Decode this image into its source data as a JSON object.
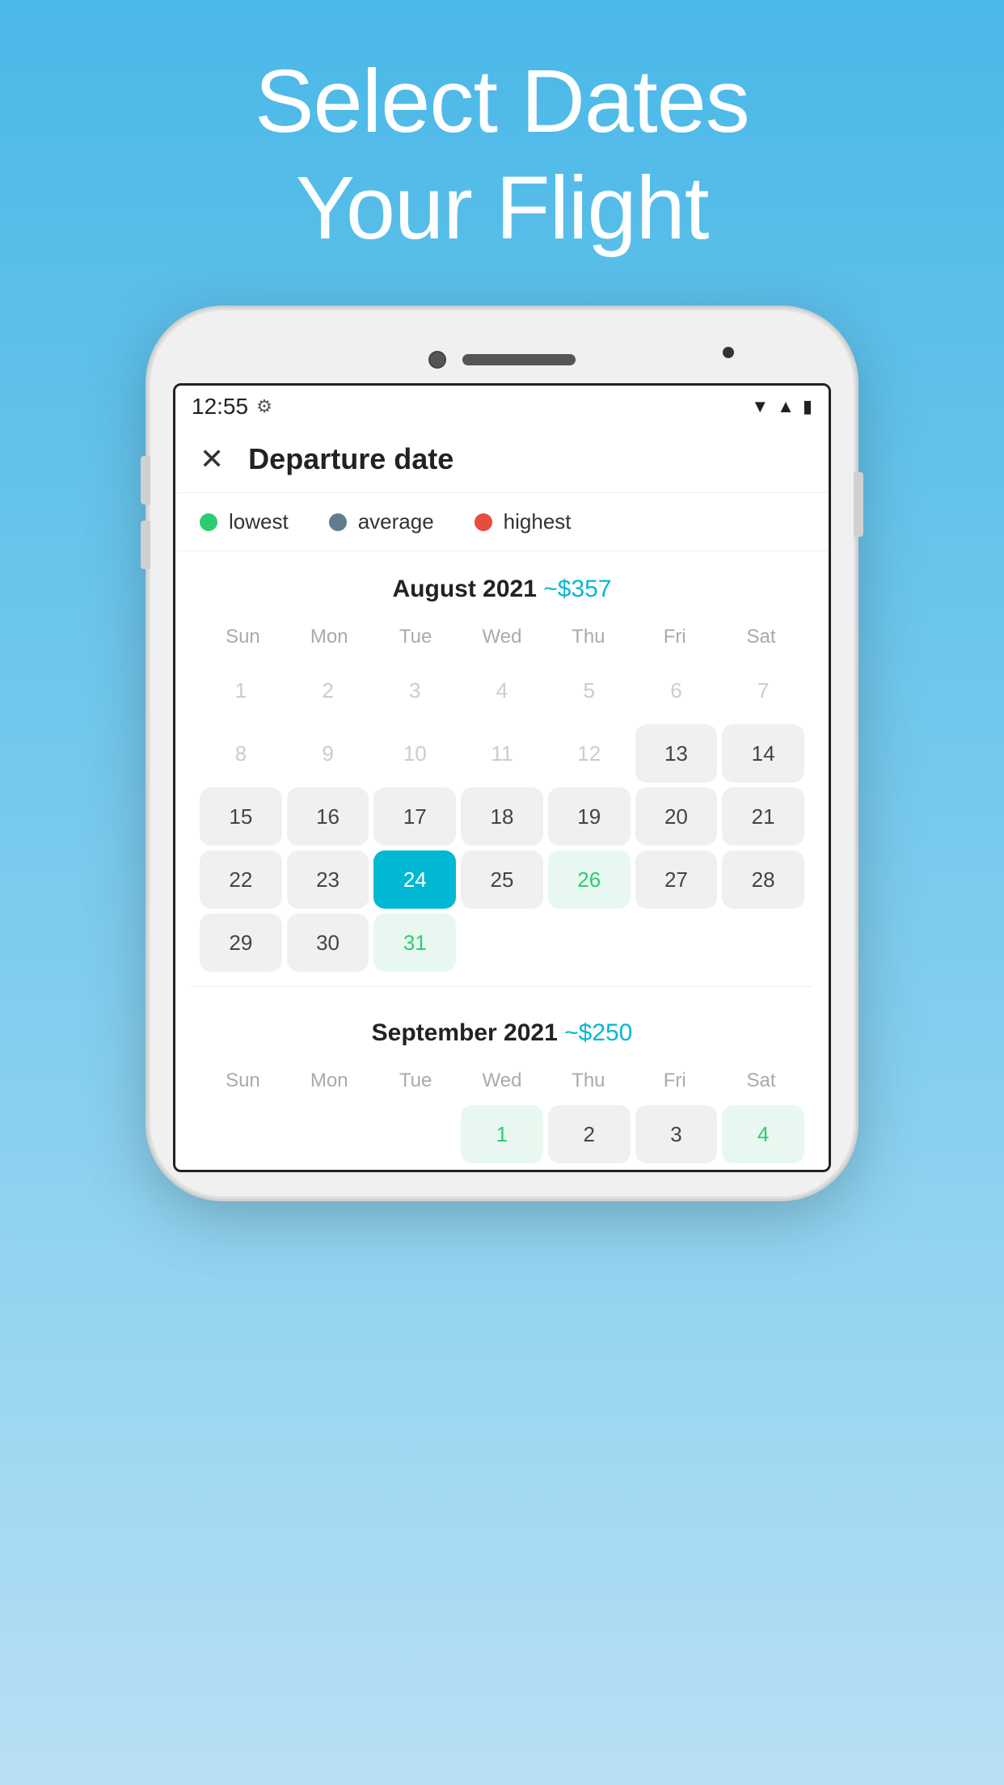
{
  "hero": {
    "line1": "Select Dates",
    "line2": "Your Flight"
  },
  "status_bar": {
    "time": "12:55",
    "gear": "⚙"
  },
  "header": {
    "title": "Departure date",
    "close": "✕"
  },
  "legend": {
    "lowest_label": "lowest",
    "average_label": "average",
    "highest_label": "highest",
    "lowest_color": "#2ecc71",
    "average_color": "#607d8b",
    "highest_color": "#e74c3c"
  },
  "august": {
    "title": "August 2021",
    "price": "~$357",
    "day_names": [
      "Sun",
      "Mon",
      "Tue",
      "Wed",
      "Thu",
      "Fri",
      "Sat"
    ],
    "weeks": [
      [
        {
          "day": "1",
          "type": "disabled"
        },
        {
          "day": "2",
          "type": "disabled"
        },
        {
          "day": "3",
          "type": "disabled"
        },
        {
          "day": "4",
          "type": "disabled"
        },
        {
          "day": "5",
          "type": "disabled"
        },
        {
          "day": "6",
          "type": "disabled"
        },
        {
          "day": "7",
          "type": "disabled"
        }
      ],
      [
        {
          "day": "8",
          "type": "disabled"
        },
        {
          "day": "9",
          "type": "disabled"
        },
        {
          "day": "10",
          "type": "disabled"
        },
        {
          "day": "11",
          "type": "disabled"
        },
        {
          "day": "12",
          "type": "disabled"
        },
        {
          "day": "13",
          "type": "average"
        },
        {
          "day": "14",
          "type": "average"
        }
      ],
      [
        {
          "day": "15",
          "type": "average"
        },
        {
          "day": "16",
          "type": "average"
        },
        {
          "day": "17",
          "type": "average"
        },
        {
          "day": "18",
          "type": "average"
        },
        {
          "day": "19",
          "type": "average"
        },
        {
          "day": "20",
          "type": "average"
        },
        {
          "day": "21",
          "type": "average"
        }
      ],
      [
        {
          "day": "22",
          "type": "average"
        },
        {
          "day": "23",
          "type": "average"
        },
        {
          "day": "24",
          "type": "selected"
        },
        {
          "day": "25",
          "type": "average"
        },
        {
          "day": "26",
          "type": "lowest"
        },
        {
          "day": "27",
          "type": "average"
        },
        {
          "day": "28",
          "type": "average"
        }
      ],
      [
        {
          "day": "29",
          "type": "average"
        },
        {
          "day": "30",
          "type": "average"
        },
        {
          "day": "31",
          "type": "lowest"
        },
        {
          "day": "",
          "type": "empty"
        },
        {
          "day": "",
          "type": "empty"
        },
        {
          "day": "",
          "type": "empty"
        },
        {
          "day": "",
          "type": "empty"
        }
      ]
    ]
  },
  "september": {
    "title": "September 2021",
    "price": "~$250",
    "day_names": [
      "Sun",
      "Mon",
      "Tue",
      "Wed",
      "Thu",
      "Fri",
      "Sat"
    ],
    "weeks": [
      [
        {
          "day": "",
          "type": "empty"
        },
        {
          "day": "",
          "type": "empty"
        },
        {
          "day": "",
          "type": "empty"
        },
        {
          "day": "1",
          "type": "lowest"
        },
        {
          "day": "2",
          "type": "average"
        },
        {
          "day": "3",
          "type": "average"
        },
        {
          "day": "4",
          "type": "lowest"
        }
      ]
    ]
  }
}
